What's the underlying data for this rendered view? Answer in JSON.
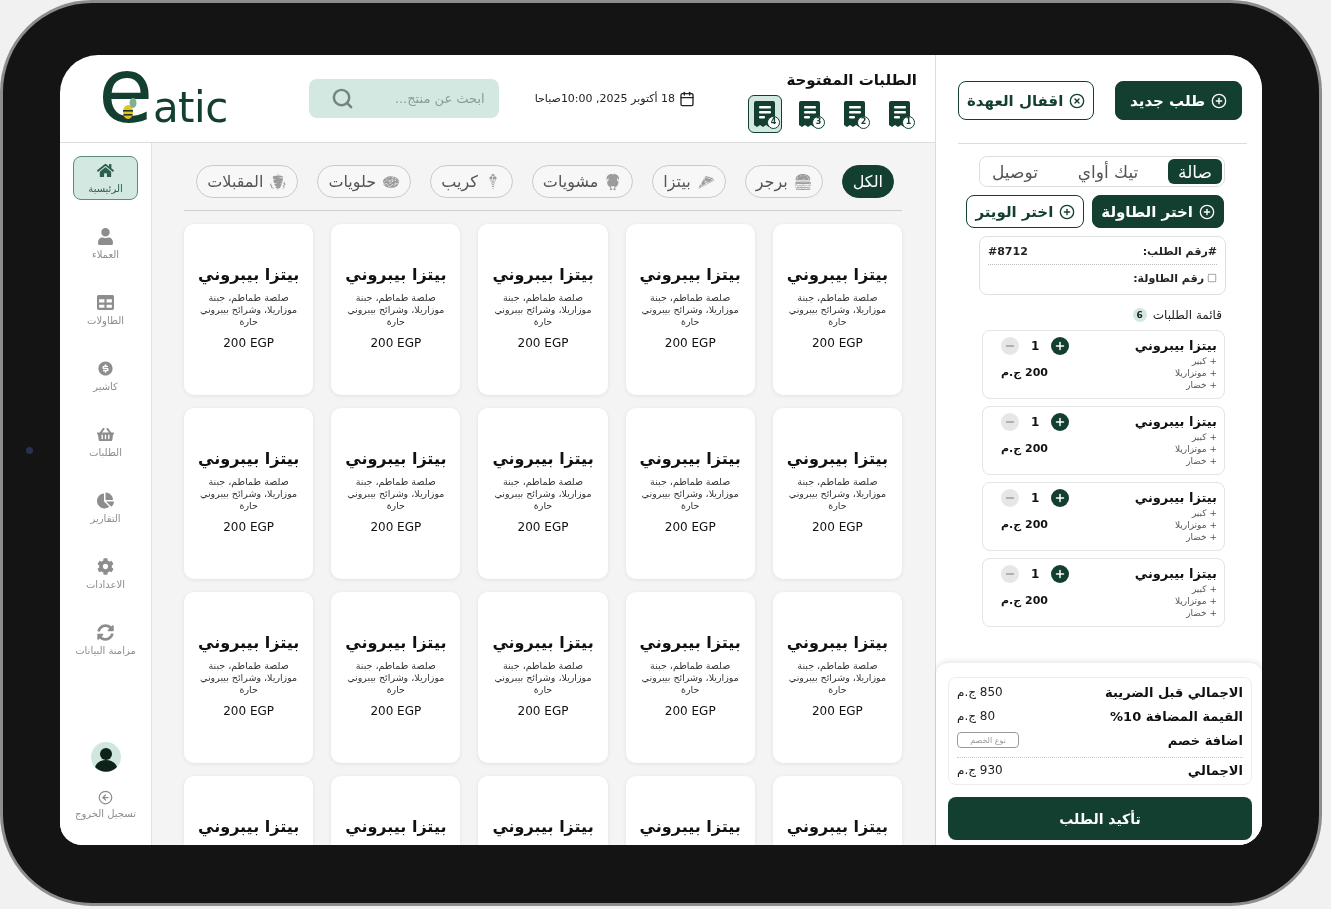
{
  "header": {
    "logo": "eatic",
    "search": {
      "placeholder": "ابحث عن منتج..."
    },
    "date": "18 أكتوبر 2025, 10:00صباحا",
    "open_orders": {
      "title": "الطلبات المفتوحة",
      "tickets": [
        {
          "number": "1",
          "selected": false
        },
        {
          "number": "2",
          "selected": false
        },
        {
          "number": "3",
          "selected": false
        },
        {
          "number": "4",
          "selected": true
        }
      ]
    }
  },
  "sidebar": {
    "items": [
      {
        "label": "الرئيسية",
        "selected": true
      },
      {
        "label": "العملاء",
        "selected": false
      },
      {
        "label": "الطاولات",
        "selected": false
      },
      {
        "label": "كاشير",
        "selected": false
      },
      {
        "label": "الطلبات",
        "selected": false
      },
      {
        "label": "التقارير",
        "selected": false
      },
      {
        "label": "الاعدادات",
        "selected": false
      },
      {
        "label": "مزامنة البيانات",
        "selected": false
      }
    ],
    "logout": "تسجيل الخروج"
  },
  "categories": [
    {
      "label": "الكل",
      "selected": true
    },
    {
      "label": "برجر",
      "selected": false
    },
    {
      "label": "بيتزا",
      "selected": false
    },
    {
      "label": "مشويات",
      "selected": false
    },
    {
      "label": "كريب",
      "selected": false
    },
    {
      "label": "حلويات",
      "selected": false
    },
    {
      "label": "المقبلات",
      "selected": false
    }
  ],
  "products": [
    {
      "name": "بيتزا بيبروني",
      "description": "صلصة طماطم، جبنة موزاريلا، وشرائح بيبروني حارة",
      "price": "200 EGP"
    },
    {
      "name": "بيتزا بيبروني",
      "description": "صلصة طماطم، جبنة موزاريلا، وشرائح بيبروني حارة",
      "price": "200 EGP"
    },
    {
      "name": "بيتزا بيبروني",
      "description": "صلصة طماطم، جبنة موزاريلا، وشرائح بيبروني حارة",
      "price": "200 EGP"
    },
    {
      "name": "بيتزا بيبروني",
      "description": "صلصة طماطم، جبنة موزاريلا، وشرائح بيبروني حارة",
      "price": "200 EGP"
    },
    {
      "name": "بيتزا بيبروني",
      "description": "صلصة طماطم، جبنة موزاريلا، وشرائح بيبروني حارة",
      "price": "200 EGP"
    },
    {
      "name": "بيتزا بيبروني",
      "description": "صلصة طماطم، جبنة موزاريلا، وشرائح بيبروني حارة",
      "price": "200 EGP"
    },
    {
      "name": "بيتزا بيبروني",
      "description": "صلصة طماطم، جبنة موزاريلا، وشرائح بيبروني حارة",
      "price": "200 EGP"
    },
    {
      "name": "بيتزا بيبروني",
      "description": "صلصة طماطم، جبنة موزاريلا، وشرائح بيبروني حارة",
      "price": "200 EGP"
    },
    {
      "name": "بيتزا بيبروني",
      "description": "صلصة طماطم، جبنة موزاريلا، وشرائح بيبروني حارة",
      "price": "200 EGP"
    },
    {
      "name": "بيتزا بيبروني",
      "description": "صلصة طماطم، جبنة موزاريلا، وشرائح بيبروني حارة",
      "price": "200 EGP"
    },
    {
      "name": "بيتزا بيبروني",
      "description": "صلصة طماطم، جبنة موزاريلا، وشرائح بيبروني حارة",
      "price": "200 EGP"
    },
    {
      "name": "بيتزا بيبروني",
      "description": "صلصة طماطم، جبنة موزاريلا، وشرائح بيبروني حارة",
      "price": "200 EGP"
    },
    {
      "name": "بيتزا بيبروني",
      "description": "صلصة طماطم، جبنة موزاريلا، وشرائح بيبروني حارة",
      "price": "200 EGP"
    },
    {
      "name": "بيتزا بيبروني",
      "description": "صلصة طماطم، جبنة موزاريلا، وشرائح بيبروني حارة",
      "price": "200 EGP"
    },
    {
      "name": "بيتزا بيبروني",
      "description": "صلصة طماطم، جبنة موزاريلا، وشرائح بيبروني حارة",
      "price": "200 EGP"
    },
    {
      "name": "بيتزا بيبروني"
    },
    {
      "name": "بيتزا بيبروني"
    },
    {
      "name": "بيتزا بيبروني"
    },
    {
      "name": "بيتزا بيبروني"
    },
    {
      "name": "بيتزا بيبروني"
    }
  ],
  "order_panel": {
    "actions": [
      {
        "label": "طلب جديد",
        "kind": "primary"
      },
      {
        "label": "اقفال العهدة",
        "kind": "outline"
      }
    ],
    "order_types": [
      {
        "label": "صالة",
        "selected": true
      },
      {
        "label": "تيك أواي",
        "selected": false
      },
      {
        "label": "توصيل",
        "selected": false
      }
    ],
    "pickers": [
      {
        "label": "اختر الطاولة",
        "kind": "primary"
      },
      {
        "label": "اختر الويتر",
        "kind": "outline"
      }
    ],
    "info": {
      "order_number_label": "#رقم الطلب:",
      "order_number": "#8712",
      "table_label": "رقم الطاولة:"
    },
    "items_title": "قائمة الطلبات",
    "items_count": "6",
    "items": [
      {
        "name": "بيتزا بيبروني",
        "modifiers": [
          "+ كبير",
          "+ موتزاريلا",
          "+ خضار"
        ],
        "quantity": "1",
        "price": "200 ج.م"
      },
      {
        "name": "بيتزا بيبروني",
        "modifiers": [
          "+ كبير",
          "+ موتزاريلا",
          "+ خضار"
        ],
        "quantity": "1",
        "price": "200 ج.م"
      },
      {
        "name": "بيتزا بيبروني",
        "modifiers": [
          "+ كبير",
          "+ موتزاريلا",
          "+ خضار"
        ],
        "quantity": "1",
        "price": "200 ج.م"
      },
      {
        "name": "بيتزا بيبروني",
        "modifiers": [
          "+ كبير",
          "+ موتزاريلا",
          "+ خضار"
        ],
        "quantity": "1",
        "price": "200 ج.م"
      }
    ],
    "summary": {
      "rows": [
        {
          "kind": "amount",
          "label": "الاجمالي قبل الضريبة",
          "value": "850 ج.م"
        },
        {
          "kind": "amount",
          "label": "القيمة المضافة 10%",
          "value": "80 ج.م"
        },
        {
          "kind": "discount",
          "label": "اضافة خصم",
          "placeholder": "نوع الخصم"
        },
        {
          "kind": "total",
          "label": "الاجمالي",
          "value": "930 ج.م"
        }
      ],
      "confirm": "تأكيد الطلب"
    }
  }
}
